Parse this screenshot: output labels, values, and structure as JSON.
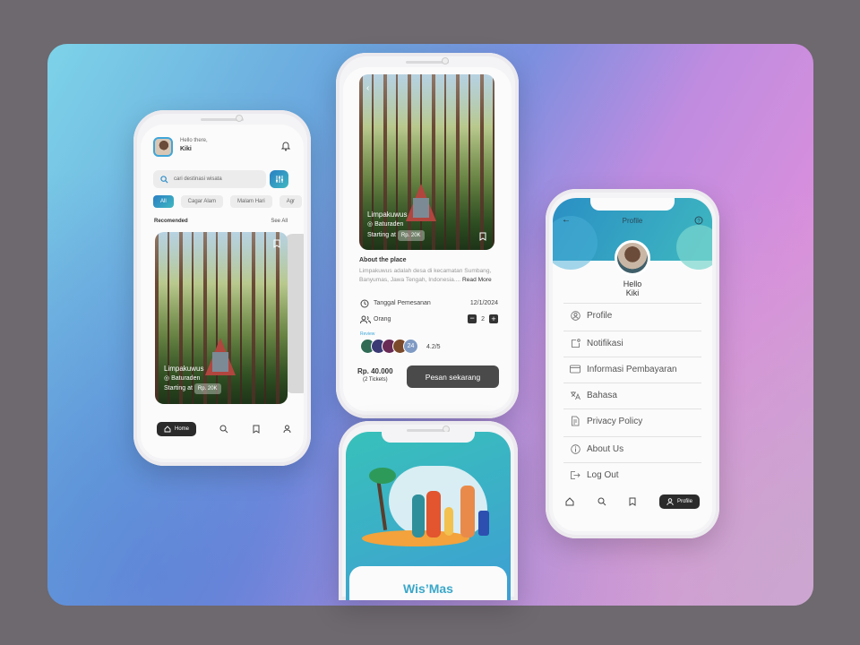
{
  "home": {
    "greeting": "Hello there,",
    "user": "Kiki",
    "search_placeholder": "cari destinasi wisata",
    "chips": [
      "All",
      "Cagar Alam",
      "Malam Hari",
      "Agr"
    ],
    "section_title": "Recomended",
    "see_all": "See All",
    "card": {
      "title": "Limpakuwus",
      "location": "Baturaden",
      "starting": "Starting at",
      "price_tag": "Rp. 20K"
    },
    "nav": {
      "home": "Home"
    }
  },
  "detail": {
    "hero": {
      "title": "Limpakuwus",
      "location": "Baturaden",
      "starting": "Starting at",
      "price_tag": "Rp. 20K"
    },
    "about_title": "About the place",
    "about_text": "Limpakuwus adalah desa di kecamatan Sumbang, Banyumas, Jawa Tengah, Indonesia....",
    "read_more": "Read More",
    "date_label": "Tanggal Pemesanan",
    "date_value": "12/1/2024",
    "people_label": "Orang",
    "people_count": "2",
    "review_label": "Review",
    "review_count": "24",
    "rating": "4.2/5",
    "price": "Rp. 40.000",
    "tickets": "(2 Tickets)",
    "cta": "Pesan sekarang"
  },
  "splash": {
    "brand": "Wis’Mas"
  },
  "profile": {
    "title": "Profile",
    "hello": "Hello",
    "name": "Kiki",
    "menu": [
      "Profile",
      "Notifikasi",
      "Informasi Pembayaran",
      "Bahasa",
      "Privacy Policy",
      "About Us",
      "Log Out"
    ],
    "nav": {
      "profile": "Profile"
    }
  },
  "colors": {
    "accent": "#2e8fc9",
    "dark": "#2b2b2b",
    "teal": "#3fb8c0"
  }
}
